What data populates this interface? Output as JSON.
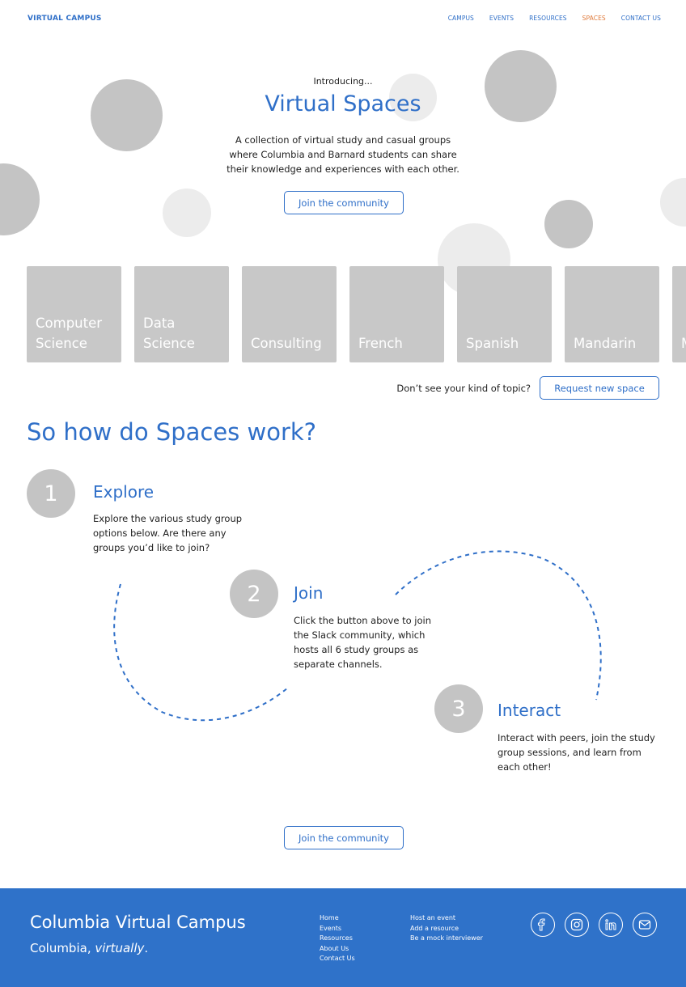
{
  "nav": {
    "brand": "VIRTUAL CAMPUS",
    "items": [
      {
        "label": "CAMPUS"
      },
      {
        "label": "EVENTS"
      },
      {
        "label": "RESOURCES"
      },
      {
        "label": "SPACES",
        "active": true
      },
      {
        "label": "CONTACT US"
      }
    ]
  },
  "hero": {
    "kicker": "Introducing...",
    "title": "Virtual Spaces",
    "description": "A collection of virtual study and casual groups where Columbia and Barnard students can share their knowledge and experiences with each other.",
    "cta": "Join the community"
  },
  "spaces": [
    {
      "label": "Computer\nScience"
    },
    {
      "label": "Data\nScience"
    },
    {
      "label": "Consulting"
    },
    {
      "label": "French"
    },
    {
      "label": "Spanish"
    },
    {
      "label": "Mandarin"
    },
    {
      "label": "M"
    }
  ],
  "request": {
    "question": "Don’t see your kind of topic?",
    "button": "Request new space"
  },
  "how": {
    "title": "So how do Spaces work?",
    "steps": [
      {
        "number": "1",
        "title": "Explore",
        "description": "Explore the various study group options below. Are there any groups you’d like to join?"
      },
      {
        "number": "2",
        "title": "Join",
        "description": "Click the button above to join the Slack community, which hosts all 6 study groups as separate channels."
      },
      {
        "number": "3",
        "title": "Interact",
        "description": "Interact with peers, join the study group sessions, and learn from each other!"
      }
    ],
    "cta": "Join the community"
  },
  "footer": {
    "title": "Columbia Virtual Campus",
    "tagline_prefix": "Columbia, ",
    "tagline_emph": "virtually",
    "tagline_suffix": ".",
    "links_col1": [
      "Home",
      "Events",
      "Resources",
      "About Us",
      "Contact Us"
    ],
    "links_col2": [
      "Host an event",
      "Add a resource",
      "Be a mock interviewer"
    ],
    "socials": [
      "facebook-icon",
      "instagram-icon",
      "linkedin-icon",
      "mail-icon"
    ]
  },
  "colors": {
    "brand_blue": "#2f6fc8",
    "active_nav": "#e07b3c",
    "placeholder_gray": "#c4c4c4",
    "light_gray": "#ececec",
    "footer_blue": "#2f72c9"
  }
}
